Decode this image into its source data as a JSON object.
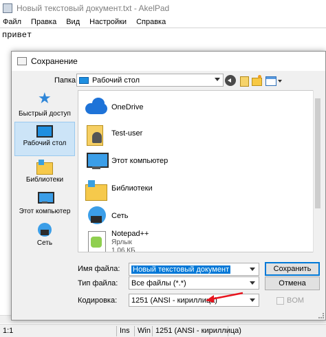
{
  "app": {
    "title": "Новый текстовый документ.txt - AkelPad",
    "menu": [
      "Файл",
      "Правка",
      "Вид",
      "Настройки",
      "Справка"
    ],
    "editor_text": "привет"
  },
  "status": {
    "position": "1:1",
    "insert_mode": "Ins",
    "newline": "Win",
    "encoding": "1251 (ANSI - кириллица)"
  },
  "dialog": {
    "title": "Сохранение",
    "folder_label": "Папка:",
    "folder_value": "Рабочий стол",
    "places": [
      "Быстрый доступ",
      "Рабочий стол",
      "Библиотеки",
      "Этот компьютер",
      "Сеть"
    ],
    "selected_place": "Рабочий стол",
    "items": [
      {
        "name": "OneDrive",
        "icon": "onedrive-cloud-icon"
      },
      {
        "name": "Test-user",
        "icon": "user-folder-icon"
      },
      {
        "name": "Этот компьютер",
        "icon": "computer-icon"
      },
      {
        "name": "Библиотеки",
        "icon": "libraries-icon"
      },
      {
        "name": "Сеть",
        "icon": "network-icon"
      },
      {
        "name": "Notepad++",
        "sub1": "Ярлык",
        "sub2": "1,06 КБ",
        "icon": "notepadpp-icon"
      }
    ],
    "filename_label": "Имя файла:",
    "filename_value": "Новый текстовый документ",
    "filetype_label": "Тип файла:",
    "filetype_value": "Все файлы (*.*)",
    "encoding_label": "Кодировка:",
    "encoding_value": "1251 (ANSI - кириллица)",
    "bom_label": "BOM",
    "save_button": "Сохранить",
    "cancel_button": "Отмена"
  },
  "colors": {
    "accent": "#0078d7",
    "annotation_arrow": "#e8141e"
  }
}
